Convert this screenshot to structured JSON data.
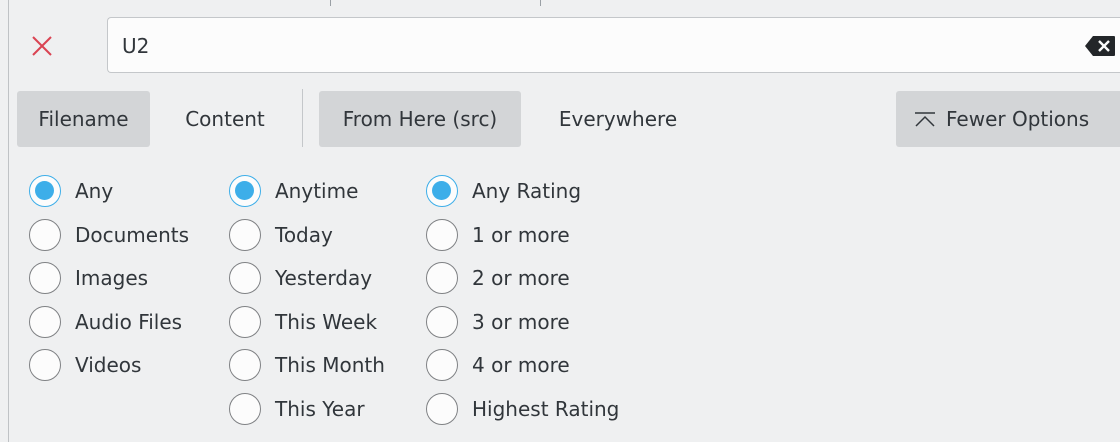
{
  "search": {
    "value": "U2",
    "placeholder": ""
  },
  "toolbar": {
    "filename_label": "Filename",
    "content_label": "Content",
    "from_here_label": "From Here (src)",
    "everywhere_label": "Everywhere",
    "fewer_options_label": "Fewer Options"
  },
  "type_options": [
    "Any",
    "Documents",
    "Images",
    "Audio Files",
    "Videos"
  ],
  "date_options": [
    "Anytime",
    "Today",
    "Yesterday",
    "This Week",
    "This Month",
    "This Year"
  ],
  "rating_options": [
    "Any Rating",
    "1 or more",
    "2 or more",
    "3 or more",
    "4 or more",
    "Highest Rating"
  ],
  "selected": {
    "type": "Any",
    "date": "Anytime",
    "rating": "Any Rating"
  },
  "colors": {
    "accent": "#3daee9",
    "close": "#da4453",
    "checked_button": "#d3d5d7",
    "background": "#eff0f1"
  },
  "icons": {
    "close": "close-icon",
    "clear": "backspace-icon",
    "fewer_options": "collapse-up-icon"
  }
}
